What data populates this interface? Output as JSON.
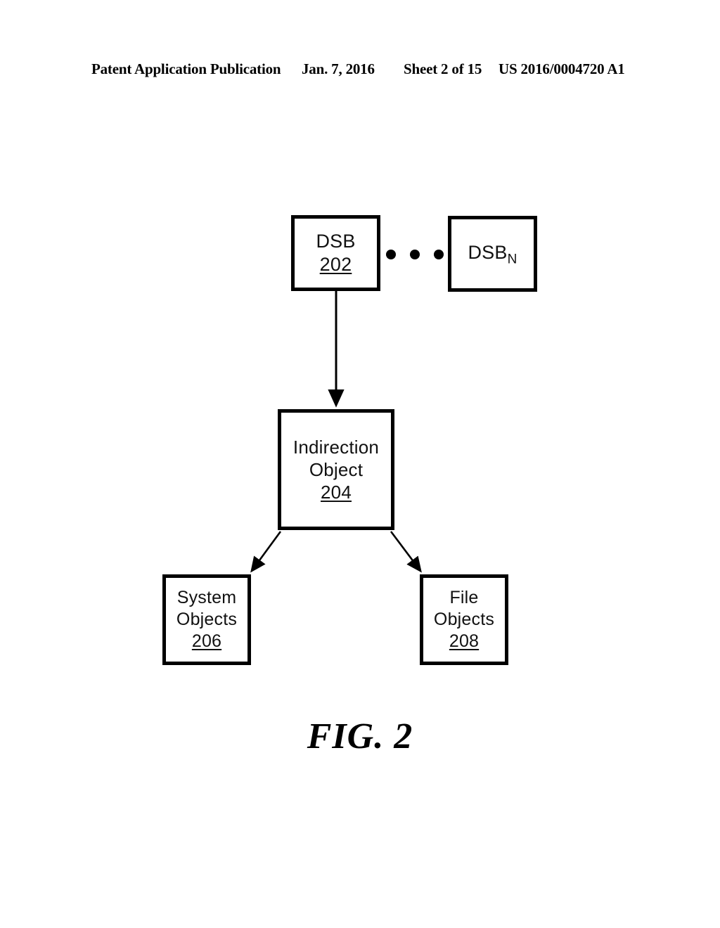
{
  "header": {
    "publication": "Patent Application Publication",
    "date": "Jan. 7, 2016",
    "sheet": "Sheet 2 of 15",
    "doc_number": "US 2016/0004720 A1"
  },
  "figure": {
    "caption": "FIG. 2",
    "ellipsis": "• • •"
  },
  "diagram": {
    "type": "block-diagram",
    "nodes": [
      {
        "id": "dsb",
        "label": "DSB",
        "ref": "202",
        "subscript": ""
      },
      {
        "id": "dsb_n",
        "label": "DSB",
        "ref": "",
        "subscript": "N"
      },
      {
        "id": "indirection_object",
        "label_line1": "Indirection",
        "label_line2": "Object",
        "ref": "204",
        "subscript": ""
      },
      {
        "id": "system_objects",
        "label_line1": "System",
        "label_line2": "Objects",
        "ref": "206",
        "subscript": ""
      },
      {
        "id": "file_objects",
        "label_line1": "File",
        "label_line2": "Objects",
        "ref": "208",
        "subscript": ""
      }
    ],
    "edges": [
      {
        "from": "dsb",
        "to": "indirection_object",
        "style": "solid-arrow",
        "direction": "down"
      },
      {
        "from": "indirection_object",
        "to": "system_objects",
        "style": "solid-arrow",
        "direction": "down-left"
      },
      {
        "from": "indirection_object",
        "to": "file_objects",
        "style": "solid-arrow",
        "direction": "down-right"
      }
    ]
  },
  "colors": {
    "ink": "#000000",
    "paper": "#ffffff"
  }
}
